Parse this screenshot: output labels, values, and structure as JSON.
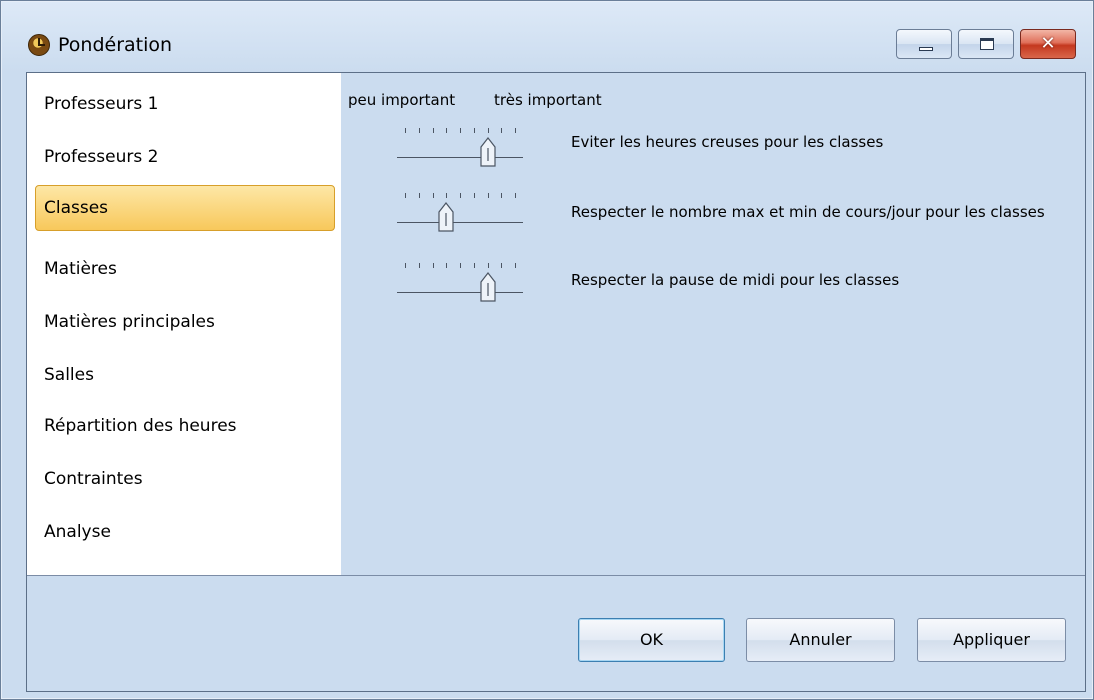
{
  "window": {
    "title": "Pondération",
    "app_icon": "clock-icon"
  },
  "caption_buttons": {
    "minimize_icon": "minimize-icon",
    "maximize_icon": "maximize-icon",
    "close_label": "✕"
  },
  "sidebar": {
    "items": [
      {
        "label": "Professeurs 1"
      },
      {
        "label": "Professeurs 2"
      },
      {
        "label": "Classes",
        "selected": true
      },
      {
        "label": "Matières"
      },
      {
        "label": "Matières principales"
      },
      {
        "label": "Salles"
      },
      {
        "label": "Répartition des heures"
      },
      {
        "label": "Contraintes"
      },
      {
        "label": "Analyse"
      }
    ]
  },
  "content": {
    "scale": {
      "low_label": "peu important",
      "high_label": "très important"
    },
    "rows": [
      {
        "label": "Eviter les heures creuses pour les classes",
        "slider_value": 0.75
      },
      {
        "label": "Respecter le nombre max et min de cours/jour pour les classes",
        "slider_value": 0.375
      },
      {
        "label": "Respecter la pause de midi pour les classes",
        "slider_value": 0.75
      }
    ]
  },
  "buttons": {
    "ok": "OK",
    "cancel": "Annuler",
    "apply": "Appliquer"
  },
  "colors": {
    "background": "#cbdcef",
    "selected": "#f8c85b",
    "window_border": "#6a7f99"
  }
}
